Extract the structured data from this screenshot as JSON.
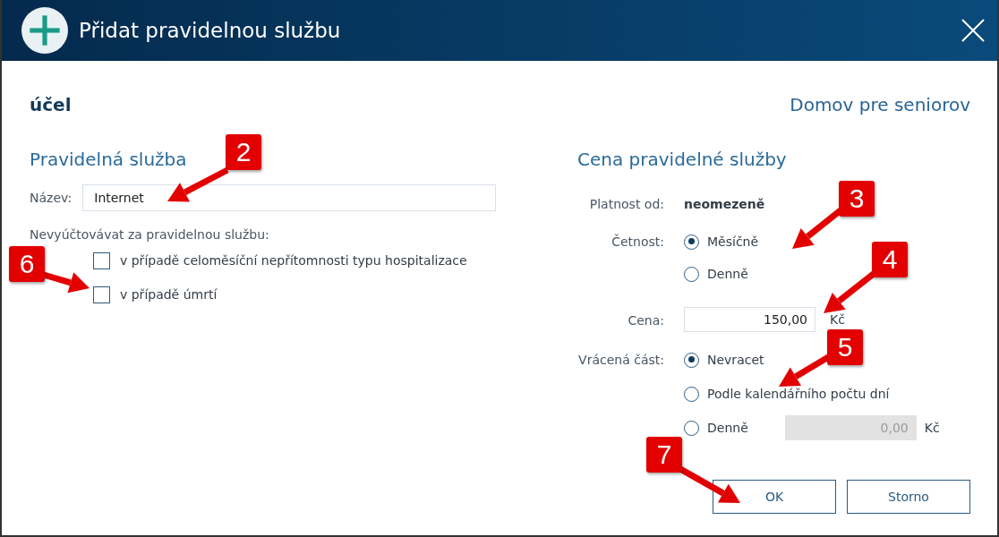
{
  "window": {
    "title": "Přidat pravidelnou službu"
  },
  "header": {
    "purpose_label": "účel",
    "facility": "Domov pre seniorov"
  },
  "service": {
    "heading": "Pravidelná služba",
    "name_label": "Název:",
    "name_value": "Internet",
    "exclude_label": "Nevyúčtovávat za pravidelnou službu:",
    "exclusions": [
      {
        "label": "v případě celoměsíční nepřítomnosti typu hospitalizace",
        "checked": false
      },
      {
        "label": "v případě úmrtí",
        "checked": false
      }
    ]
  },
  "price": {
    "heading": "Cena pravidelné služby",
    "valid_label": "Platnost od:",
    "valid_value": "neomezeně",
    "frequency_label": "Četnost:",
    "frequency": [
      {
        "label": "Měsíčně",
        "selected": true
      },
      {
        "label": "Denně",
        "selected": false
      }
    ],
    "price_label": "Cena:",
    "price_value": "150,00",
    "price_currency": "Kč",
    "refund_label": "Vrácená část:",
    "refund": [
      {
        "label": "Nevracet",
        "selected": true
      },
      {
        "label": "Podle kalendářního počtu dní",
        "selected": false
      },
      {
        "label": "Denně",
        "selected": false,
        "amount": "0,00",
        "currency": "Kč"
      }
    ]
  },
  "buttons": [
    "OK",
    "Storno"
  ],
  "annotations": [
    {
      "number": "2"
    },
    {
      "number": "3"
    },
    {
      "number": "4"
    },
    {
      "number": "5"
    },
    {
      "number": "6"
    },
    {
      "number": "7"
    }
  ]
}
